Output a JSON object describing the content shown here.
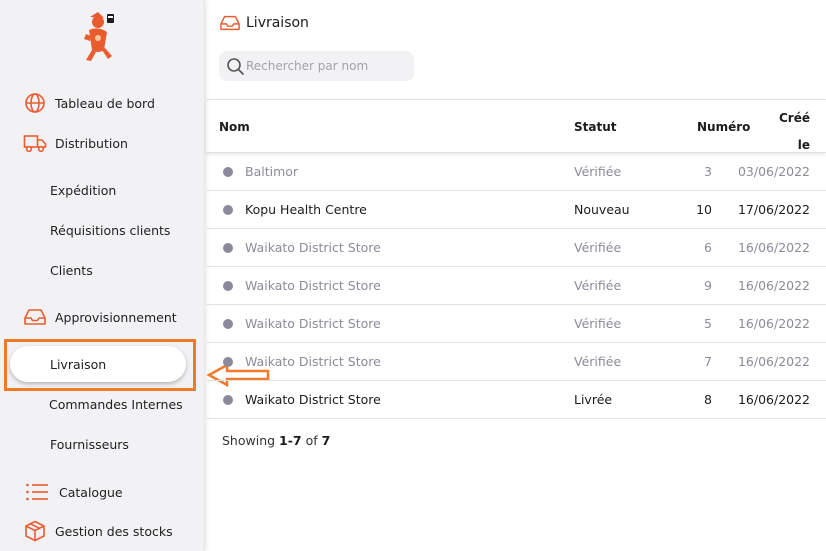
{
  "sidebar": {
    "items": [
      {
        "label": "Tableau de bord",
        "icon": "globe-icon"
      },
      {
        "label": "Distribution",
        "icon": "truck-icon"
      },
      {
        "label": "Expédition"
      },
      {
        "label": "Réquisitions clients"
      },
      {
        "label": "Clients"
      },
      {
        "label": "Approvisionnement",
        "icon": "inbox-icon"
      },
      {
        "label": "Livraison",
        "active": true
      },
      {
        "label": "Commandes Internes"
      },
      {
        "label": "Fournisseurs"
      },
      {
        "label": "Catalogue",
        "icon": "list-icon"
      },
      {
        "label": "Gestion des stocks",
        "icon": "cube-icon"
      }
    ],
    "accent_color": "#e95c30"
  },
  "header": {
    "title": "Livraison"
  },
  "search": {
    "placeholder": "Rechercher par nom"
  },
  "table": {
    "columns": {
      "name": "Nom",
      "status": "Statut",
      "number": "Numéro",
      "created_1": "Créé",
      "created_2": "le"
    },
    "rows": [
      {
        "name": "Baltimor",
        "status": "Vérifiée",
        "number": "3",
        "date": "03/06/2022"
      },
      {
        "name": "Kopu Health Centre",
        "status": "Nouveau",
        "number": "10",
        "date": "17/06/2022"
      },
      {
        "name": "Waikato District Store",
        "status": "Vérifiée",
        "number": "6",
        "date": "16/06/2022"
      },
      {
        "name": "Waikato District Store",
        "status": "Vérifiée",
        "number": "9",
        "date": "16/06/2022"
      },
      {
        "name": "Waikato District Store",
        "status": "Vérifiée",
        "number": "5",
        "date": "16/06/2022"
      },
      {
        "name": "Waikato District Store",
        "status": "Vérifiée",
        "number": "7",
        "date": "16/06/2022"
      },
      {
        "name": "Waikato District Store",
        "status": "Livrée",
        "number": "8",
        "date": "16/06/2022"
      }
    ]
  },
  "footer": {
    "prefix": "Showing ",
    "range": "1-7",
    "of": " of ",
    "total": "7"
  }
}
